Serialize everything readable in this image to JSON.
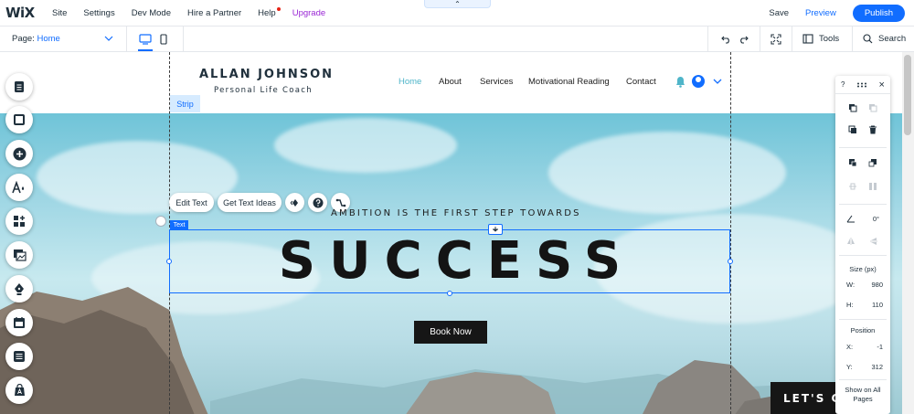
{
  "topbar": {
    "logo": "WiX",
    "menu": [
      "Site",
      "Settings",
      "Dev Mode",
      "Hire a Partner",
      "Help",
      "Upgrade"
    ],
    "collapse_glyph": "⌃",
    "save": "Save",
    "preview": "Preview",
    "publish": "Publish"
  },
  "toolbar": {
    "page_prefix": "Page:",
    "page_name": "Home",
    "tools_label": "Tools",
    "search_label": "Search"
  },
  "site": {
    "name": "ALLAN JOHNSON",
    "tagline": "Personal Life Coach",
    "nav": [
      "Home",
      "About",
      "Services",
      "Motivational Reading",
      "Contact"
    ],
    "active_nav": "Home"
  },
  "editor": {
    "strip_label": "Strip",
    "edit_text": "Edit Text",
    "get_text_ideas": "Get Text Ideas",
    "text_tag": "Text"
  },
  "hero": {
    "subtitle": "AMBITION IS THE FIRST STEP TOWARDS",
    "headline": "SUCCESS",
    "cta": "Book Now",
    "chat": "LET'S CHAT"
  },
  "inspector": {
    "help": "?",
    "close": "×",
    "rotation": "0°",
    "size_label": "Size (px)",
    "w_label": "W:",
    "w_value": "980",
    "h_label": "H:",
    "h_value": "110",
    "position_label": "Position",
    "x_label": "X:",
    "x_value": "-1",
    "y_label": "Y:",
    "y_value": "312",
    "show_all": "Show on All Pages"
  },
  "colors": {
    "accent": "#116dff",
    "upgrade": "#9a27d5",
    "nav_active": "#4fb5c9",
    "button_dark": "#161616"
  }
}
